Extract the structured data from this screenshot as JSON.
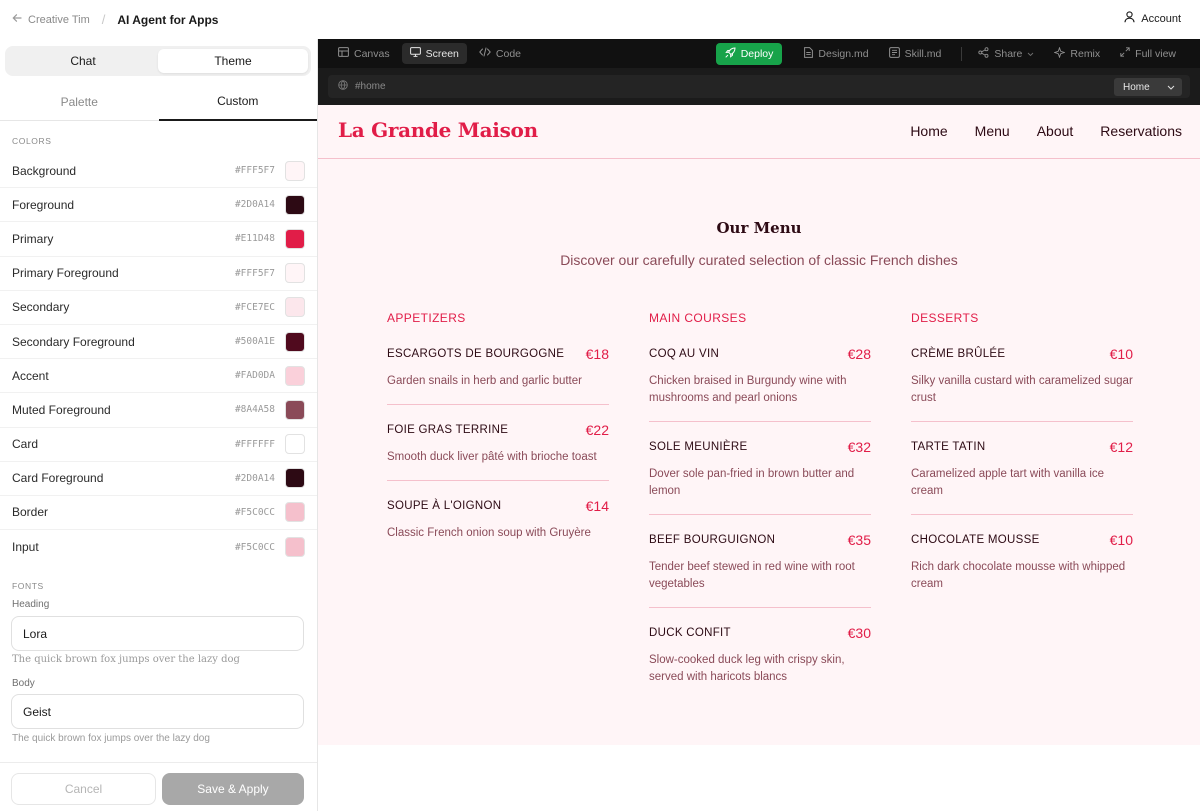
{
  "header": {
    "back_label": "Creative Tim",
    "title": "AI Agent for Apps",
    "account_label": "Account"
  },
  "left_panel": {
    "mode_tabs": [
      {
        "label": "Chat",
        "active": false
      },
      {
        "label": "Theme",
        "active": true
      }
    ],
    "sub_tabs": [
      {
        "label": "Palette",
        "active": false
      },
      {
        "label": "Custom",
        "active": true
      }
    ],
    "colors_label": "COLORS",
    "colors": [
      {
        "name": "Background",
        "hex": "#FFF5F7"
      },
      {
        "name": "Foreground",
        "hex": "#2D0A14"
      },
      {
        "name": "Primary",
        "hex": "#E11D48"
      },
      {
        "name": "Primary Foreground",
        "hex": "#FFF5F7"
      },
      {
        "name": "Secondary",
        "hex": "#FCE7EC"
      },
      {
        "name": "Secondary Foreground",
        "hex": "#500A1E"
      },
      {
        "name": "Accent",
        "hex": "#FAD0DA"
      },
      {
        "name": "Muted Foreground",
        "hex": "#8A4A58"
      },
      {
        "name": "Card",
        "hex": "#FFFFFF"
      },
      {
        "name": "Card Foreground",
        "hex": "#2D0A14"
      },
      {
        "name": "Border",
        "hex": "#F5C0CC"
      },
      {
        "name": "Input",
        "hex": "#F5C0CC"
      }
    ],
    "fonts_label": "FONTS",
    "heading_label": "Heading",
    "heading_value": "Lora",
    "heading_preview": "The quick brown fox jumps over the lazy dog",
    "body_label": "Body",
    "body_value": "Geist",
    "body_preview": "The quick brown fox jumps over the lazy dog",
    "cancel_label": "Cancel",
    "save_label": "Save & Apply"
  },
  "toolbar": {
    "view_tabs": [
      {
        "label": "Canvas",
        "icon": "canvas-icon",
        "active": false
      },
      {
        "label": "Screen",
        "icon": "monitor-icon",
        "active": true
      },
      {
        "label": "Code",
        "icon": "code-icon",
        "active": false
      }
    ],
    "deploy_label": "Deploy",
    "design_label": "Design.md",
    "skill_label": "Skill.md",
    "share_label": "Share",
    "remix_label": "Remix",
    "fullview_label": "Full view",
    "deploy_color": "#17A34A"
  },
  "urlbar": {
    "path": "#home",
    "route": "Home"
  },
  "site": {
    "brand": "La Grande Maison",
    "nav": [
      "Home",
      "Menu",
      "About",
      "Reservations"
    ],
    "menu_title": "Our Menu",
    "menu_subtitle": "Discover our carefully curated selection of classic French dishes",
    "columns": [
      {
        "heading": "APPETIZERS",
        "items": [
          {
            "name": "ESCARGOTS DE BOURGOGNE",
            "price": "€18",
            "desc": "Garden snails in herb and garlic butter"
          },
          {
            "name": "FOIE GRAS TERRINE",
            "price": "€22",
            "desc": "Smooth duck liver pâté with brioche toast"
          },
          {
            "name": "SOUPE À L'OIGNON",
            "price": "€14",
            "desc": "Classic French onion soup with Gruyère"
          }
        ]
      },
      {
        "heading": "MAIN COURSES",
        "items": [
          {
            "name": "COQ AU VIN",
            "price": "€28",
            "desc": "Chicken braised in Burgundy wine with mushrooms and pearl onions"
          },
          {
            "name": "SOLE MEUNIÈRE",
            "price": "€32",
            "desc": "Dover sole pan-fried in brown butter and lemon"
          },
          {
            "name": "BEEF BOURGUIGNON",
            "price": "€35",
            "desc": "Tender beef stewed in red wine with root vegetables"
          },
          {
            "name": "DUCK CONFIT",
            "price": "€30",
            "desc": "Slow-cooked duck leg with crispy skin, served with haricots blancs"
          }
        ]
      },
      {
        "heading": "DESSERTS",
        "items": [
          {
            "name": "CRÈME BRÛLÉE",
            "price": "€10",
            "desc": "Silky vanilla custard with caramelized sugar crust"
          },
          {
            "name": "TARTE TATIN",
            "price": "€12",
            "desc": "Caramelized apple tart with vanilla ice cream"
          },
          {
            "name": "CHOCOLATE MOUSSE",
            "price": "€10",
            "desc": "Rich dark chocolate mousse with whipped cream"
          }
        ]
      }
    ]
  }
}
